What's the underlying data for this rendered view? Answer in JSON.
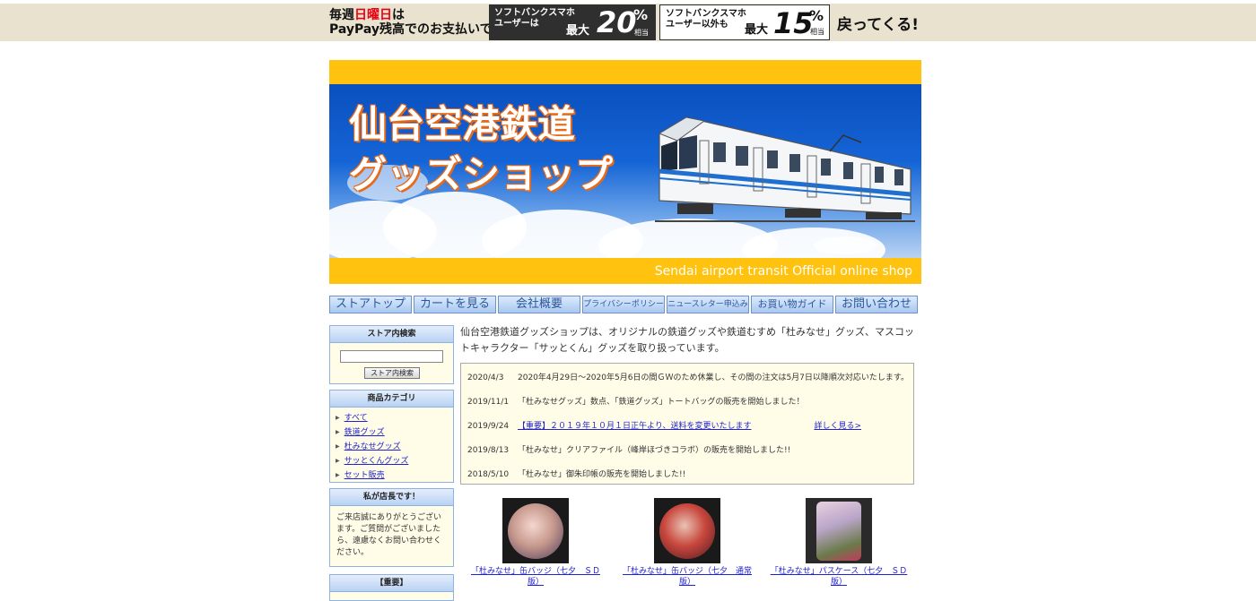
{
  "promo": {
    "left_line1_pre": "毎週",
    "left_line1_red": "日曜日",
    "left_line1_post": "は",
    "left_line2": "PayPay残高でのお支払いで",
    "box1_line1": "ソフトバンクスマホ",
    "box1_line2": "ユーザーは",
    "box1_max": "最大",
    "box1_value": "20",
    "box1_pct": "%",
    "box1_sub": "相当",
    "box2_line1": "ソフトバンクスマホ",
    "box2_line2": "ユーザー以外も",
    "box2_max": "最大",
    "box2_value": "15",
    "box2_pct": "%",
    "box2_sub": "相当",
    "right": "戻ってくる!"
  },
  "header": {
    "title_line1": "仙台空港鉄道",
    "title_line2": "グッズショップ",
    "footer": "Sendai airport transit Official online shop"
  },
  "nav": [
    {
      "label": "ストアトップ"
    },
    {
      "label": "カートを見る"
    },
    {
      "label": "会社概要"
    },
    {
      "label": "プライバシーポリシー"
    },
    {
      "label": "ニュースレター申込み"
    },
    {
      "label": "お買い物ガイド"
    },
    {
      "label": "お問い合わせ"
    }
  ],
  "sidebar": {
    "search_title": "ストア内検索",
    "search_button": "ストア内検索",
    "category_title": "商品カテゴリ",
    "categories": [
      "すべて",
      "鉄道グッズ",
      "杜みなせグッズ",
      "サッとくんグッズ",
      "セット販売"
    ],
    "owner_title": "私が店長です！",
    "owner_text": "ご来店誠にありがとうございます。ご質問がございましたら、遠慮なくお問い合わせください。",
    "important_title": "【重要】"
  },
  "main": {
    "intro": "仙台空港鉄道グッズショップは、オリジナルの鉄道グッズや鉄道むすめ「杜みなせ」グッズ、マスコットキャラクター「サッとくん」グッズを取り扱っています。",
    "news": [
      {
        "date": "2020/4/3",
        "text": "2020年4月29日～2020年5月6日の間ＧＷのため休業し、その間の注文は5月7日以降順次対応いたします。",
        "link": "",
        "more": ""
      },
      {
        "date": "2019/11/1",
        "text": "「杜みなせグッズ」数点、「鉄道グッズ」トートバッグの販売を開始しました！",
        "link": "",
        "more": ""
      },
      {
        "date": "2019/9/24",
        "text": "",
        "link": "【重要】２０１９年１０月１日正午より、送料を変更いたします",
        "more": "詳しく見る>"
      },
      {
        "date": "2019/8/13",
        "text": "「杜みなせ」クリアファイル（峰岸ほづきコラボ）の販売を開始しました!!",
        "link": "",
        "more": ""
      },
      {
        "date": "2018/5/10",
        "text": "「杜みなせ」御朱印帳の販売を開始しました!!",
        "link": "",
        "more": ""
      }
    ],
    "products": [
      {
        "name_line1": "「杜みなせ」缶バッジ（七夕　ＳＤ",
        "name_line2": "版）"
      },
      {
        "name_line1": "「杜みなせ」缶バッジ（七夕　通常",
        "name_line2": "版）"
      },
      {
        "name_line1": "「杜みなせ」パスケース（七夕　ＳＤ",
        "name_line2": "版）"
      }
    ]
  },
  "colors": {
    "header_band": "#ffc20e",
    "link": "#2222cc",
    "sidebar_bg": "#fffde8",
    "nav_border": "#6f93c6"
  }
}
